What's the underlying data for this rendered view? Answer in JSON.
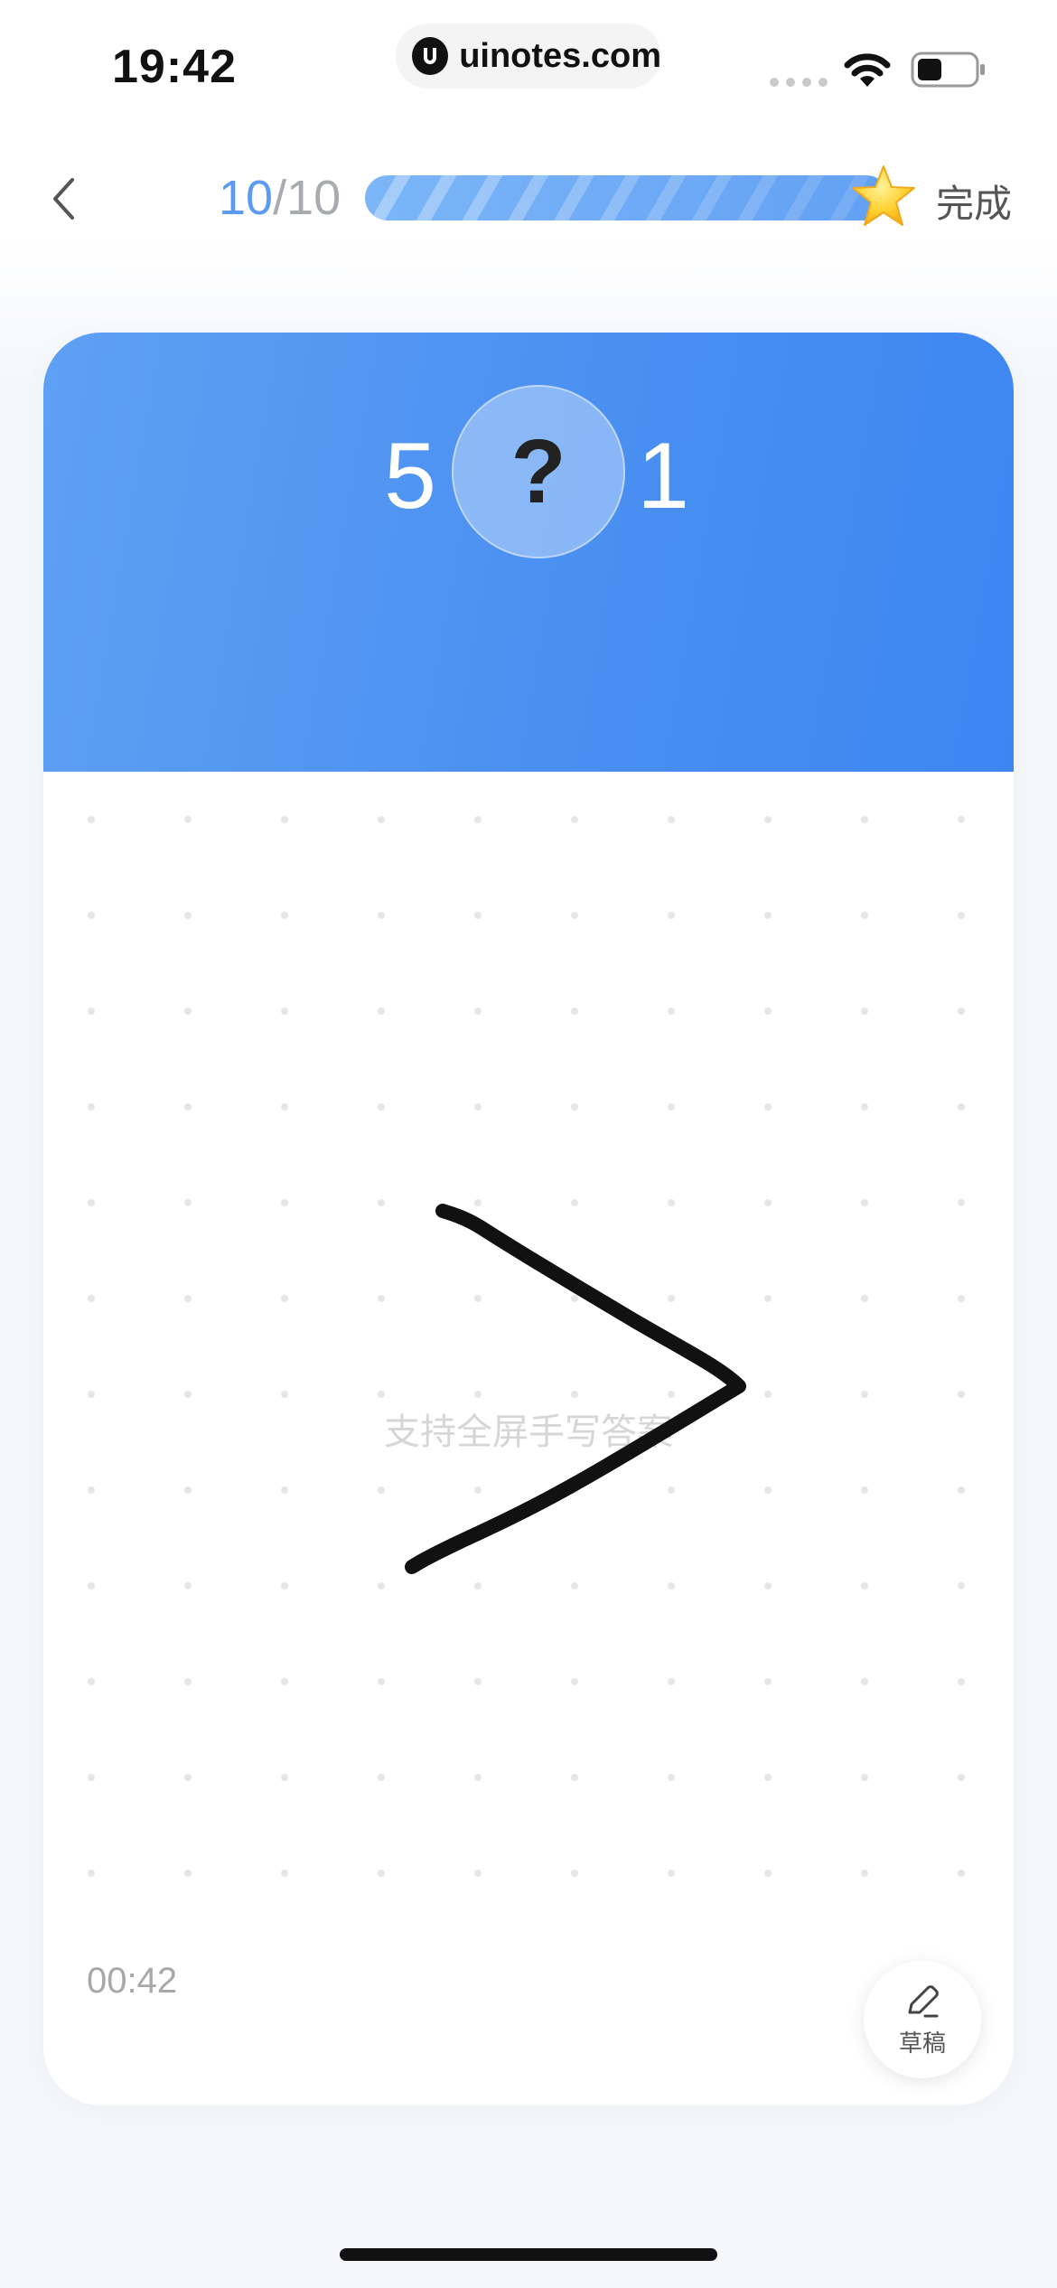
{
  "status_bar": {
    "time": "19:42",
    "url": "uinotes.com",
    "icons": [
      "signal-icon",
      "wifi-icon",
      "battery-icon"
    ]
  },
  "header": {
    "back_icon": "chevron-left-icon",
    "progress_current": "10",
    "progress_separator": "/",
    "progress_total": "10",
    "progress_fraction": 1.0,
    "star_icon": "star-icon",
    "done_label": "完成"
  },
  "question": {
    "left_number": "5",
    "answer_placeholder": "?",
    "right_number": "1"
  },
  "canvas": {
    "hint": "支持全屏手写答案",
    "handwritten_answer": ">"
  },
  "footer": {
    "timer": "00:42",
    "draft_icon": "pencil-icon",
    "draft_label": "草稿"
  },
  "colors": {
    "accent": "#4a90f1",
    "progress_text": "#5b9cf2",
    "ink": "#111111"
  }
}
